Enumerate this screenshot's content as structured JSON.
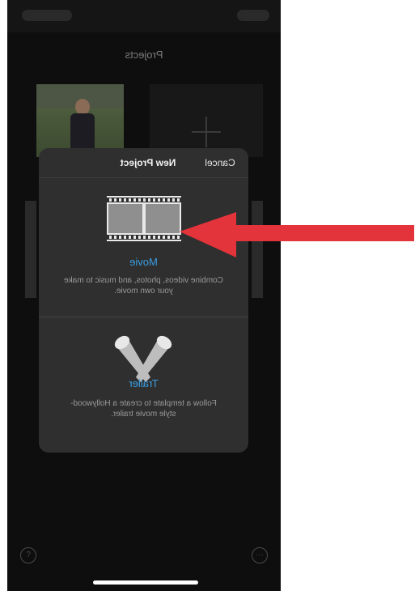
{
  "screen": {
    "title": "Projects"
  },
  "sheet": {
    "title": "New Project",
    "cancel_label": "Cancel",
    "options": [
      {
        "label": "Movie",
        "description": "Combine videos, photos, and music to make your own movie.",
        "icon": "film-strip-icon"
      },
      {
        "label": "Trailer",
        "description": "Follow a template to create a Hollywood-style movie trailer.",
        "icon": "spotlights-icon"
      }
    ]
  },
  "toolbar": {
    "help_label": "?",
    "more_label": "···"
  },
  "colors": {
    "accent": "#3a9de0",
    "arrow": "#e3333b",
    "sheet": "#2f2f2f"
  }
}
